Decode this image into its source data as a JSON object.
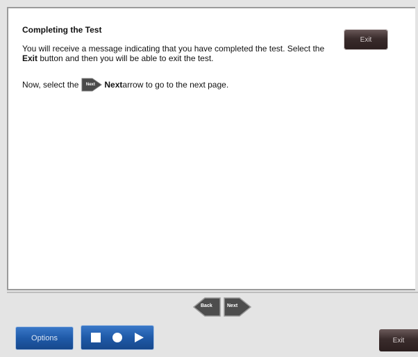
{
  "lesson": {
    "heading": "Completing the Test",
    "para1_text1": "You will receive a message indicating that you have completed the test. Select the ",
    "para1_bold": "Exit",
    "para1_text2": " button and then you will be able to exit the test.",
    "para2_text1": "Now, select the ",
    "para2_icon_label": "Next",
    "para2_bold": "Next",
    "para2_text2": " arrow to go to the next page.",
    "inline_exit_label": "Exit"
  },
  "nav": {
    "back_label": "Back",
    "next_label": "Next"
  },
  "footer": {
    "options_label": "Options",
    "exit_label": "Exit",
    "media_controls": [
      "stop-icon",
      "record-icon",
      "play-icon"
    ]
  }
}
